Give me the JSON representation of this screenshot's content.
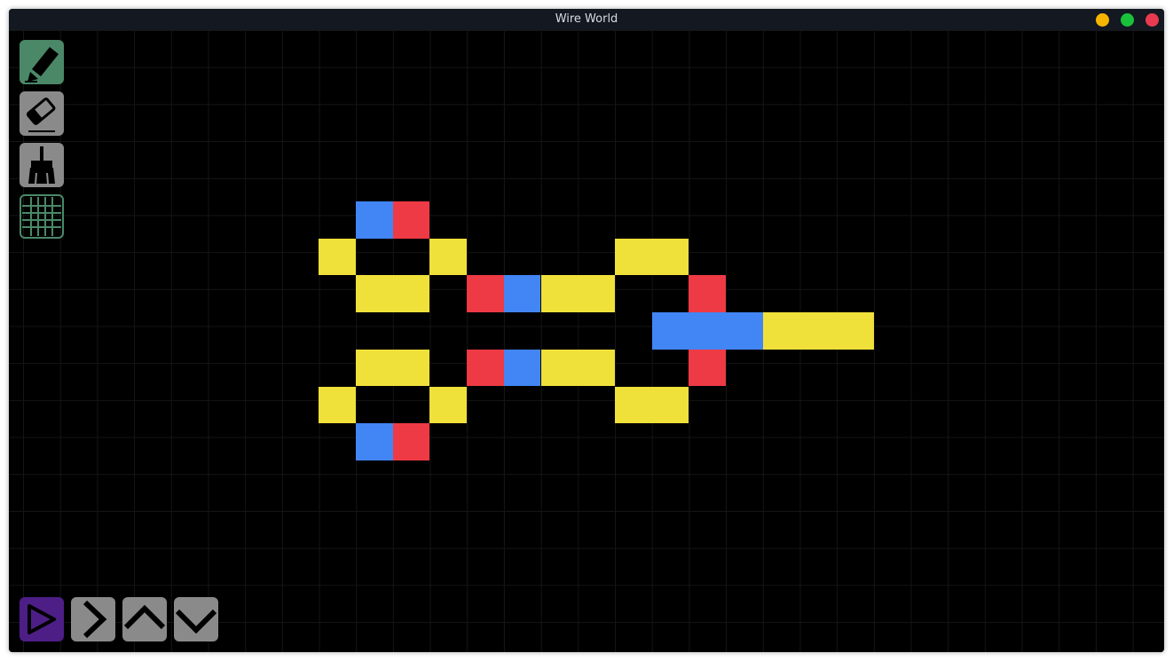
{
  "window": {
    "title": "Wire World"
  },
  "colors": {
    "empty": "#000000",
    "conductor": "#f0e03a",
    "electron_head": "#4285f4",
    "electron_tail": "#ee3a44",
    "tool_bg": "#8a8a8a",
    "tool_selected": "#4a8868",
    "play_bg": "#4d1e86",
    "btn_minimize": "#f6b500",
    "btn_maximize": "#1ac23b",
    "btn_close": "#ea3a4f"
  },
  "title_buttons": {
    "minimize": "minimize-button",
    "maximize": "maximize-button",
    "close": "close-button"
  },
  "toolbar_top": [
    {
      "id": "pencil",
      "icon": "pencil-icon",
      "selected": true
    },
    {
      "id": "eraser",
      "icon": "eraser-icon",
      "selected": false
    },
    {
      "id": "broom",
      "icon": "broom-icon",
      "selected": false
    },
    {
      "id": "grid",
      "icon": "grid-icon",
      "selected": true
    }
  ],
  "toolbar_bottom": [
    {
      "id": "play",
      "icon": "play-icon",
      "selected": true
    },
    {
      "id": "step",
      "icon": "chevron-right-icon"
    },
    {
      "id": "speed-up",
      "icon": "chevron-up-icon"
    },
    {
      "id": "speed-down",
      "icon": "chevron-down-icon"
    }
  ],
  "grid": {
    "cells": [
      {
        "col": 0,
        "row": 0,
        "state": "head"
      },
      {
        "col": 1,
        "row": 0,
        "state": "tail"
      },
      {
        "col": -1,
        "row": 1,
        "state": "conductor"
      },
      {
        "col": 2,
        "row": 1,
        "state": "conductor"
      },
      {
        "col": 7,
        "row": 1,
        "state": "conductor"
      },
      {
        "col": 8,
        "row": 1,
        "state": "conductor"
      },
      {
        "col": 0,
        "row": 2,
        "state": "conductor"
      },
      {
        "col": 1,
        "row": 2,
        "state": "conductor"
      },
      {
        "col": 3,
        "row": 2,
        "state": "tail"
      },
      {
        "col": 4,
        "row": 2,
        "state": "head"
      },
      {
        "col": 5,
        "row": 2,
        "state": "conductor"
      },
      {
        "col": 6,
        "row": 2,
        "state": "conductor"
      },
      {
        "col": 9,
        "row": 2,
        "state": "tail"
      },
      {
        "col": 8,
        "row": 3,
        "state": "head"
      },
      {
        "col": 9,
        "row": 3,
        "state": "head"
      },
      {
        "col": 10,
        "row": 3,
        "state": "head"
      },
      {
        "col": 11,
        "row": 3,
        "state": "conductor"
      },
      {
        "col": 12,
        "row": 3,
        "state": "conductor"
      },
      {
        "col": 13,
        "row": 3,
        "state": "conductor"
      },
      {
        "col": 0,
        "row": 4,
        "state": "conductor"
      },
      {
        "col": 1,
        "row": 4,
        "state": "conductor"
      },
      {
        "col": 3,
        "row": 4,
        "state": "tail"
      },
      {
        "col": 4,
        "row": 4,
        "state": "head"
      },
      {
        "col": 5,
        "row": 4,
        "state": "conductor"
      },
      {
        "col": 6,
        "row": 4,
        "state": "conductor"
      },
      {
        "col": 9,
        "row": 4,
        "state": "tail"
      },
      {
        "col": -1,
        "row": 5,
        "state": "conductor"
      },
      {
        "col": 2,
        "row": 5,
        "state": "conductor"
      },
      {
        "col": 7,
        "row": 5,
        "state": "conductor"
      },
      {
        "col": 8,
        "row": 5,
        "state": "conductor"
      },
      {
        "col": 0,
        "row": 6,
        "state": "head"
      },
      {
        "col": 1,
        "row": 6,
        "state": "tail"
      }
    ]
  }
}
